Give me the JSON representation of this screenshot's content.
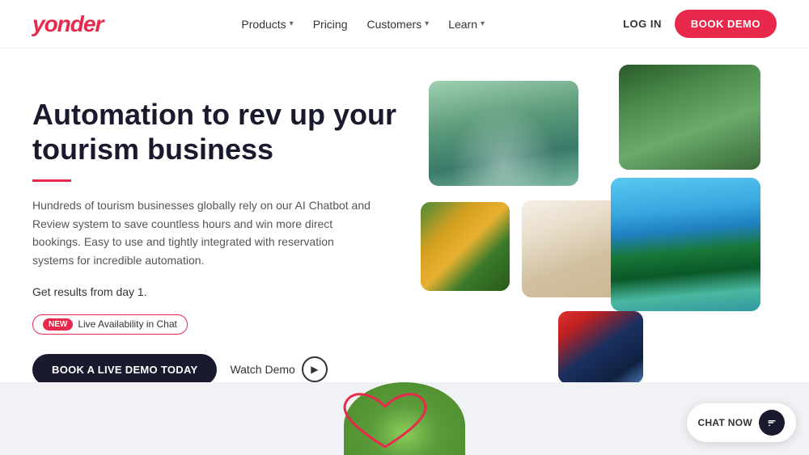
{
  "nav": {
    "logo": "yonder",
    "links": [
      {
        "label": "Products",
        "hasDropdown": true
      },
      {
        "label": "Pricing",
        "hasDropdown": false
      },
      {
        "label": "Customers",
        "hasDropdown": true
      },
      {
        "label": "Learn",
        "hasDropdown": true
      }
    ],
    "login_label": "LOG IN",
    "book_demo_label": "BOOK DEMO"
  },
  "hero": {
    "title": "Automation to rev up your tourism business",
    "description": "Hundreds of tourism businesses globally rely on our AI Chatbot and Review system to save countless hours and win more direct bookings. Easy to use and tightly integrated with reservation systems for incredible automation.",
    "results_text": "Get results from day 1.",
    "badge": {
      "new_tag": "NEW",
      "text": "Live Availability in Chat"
    },
    "book_demo_label": "BOOK A LIVE DEMO TODAY",
    "watch_demo_label": "Watch Demo"
  },
  "bottom": {
    "chat_label": "CHAT NOW"
  }
}
